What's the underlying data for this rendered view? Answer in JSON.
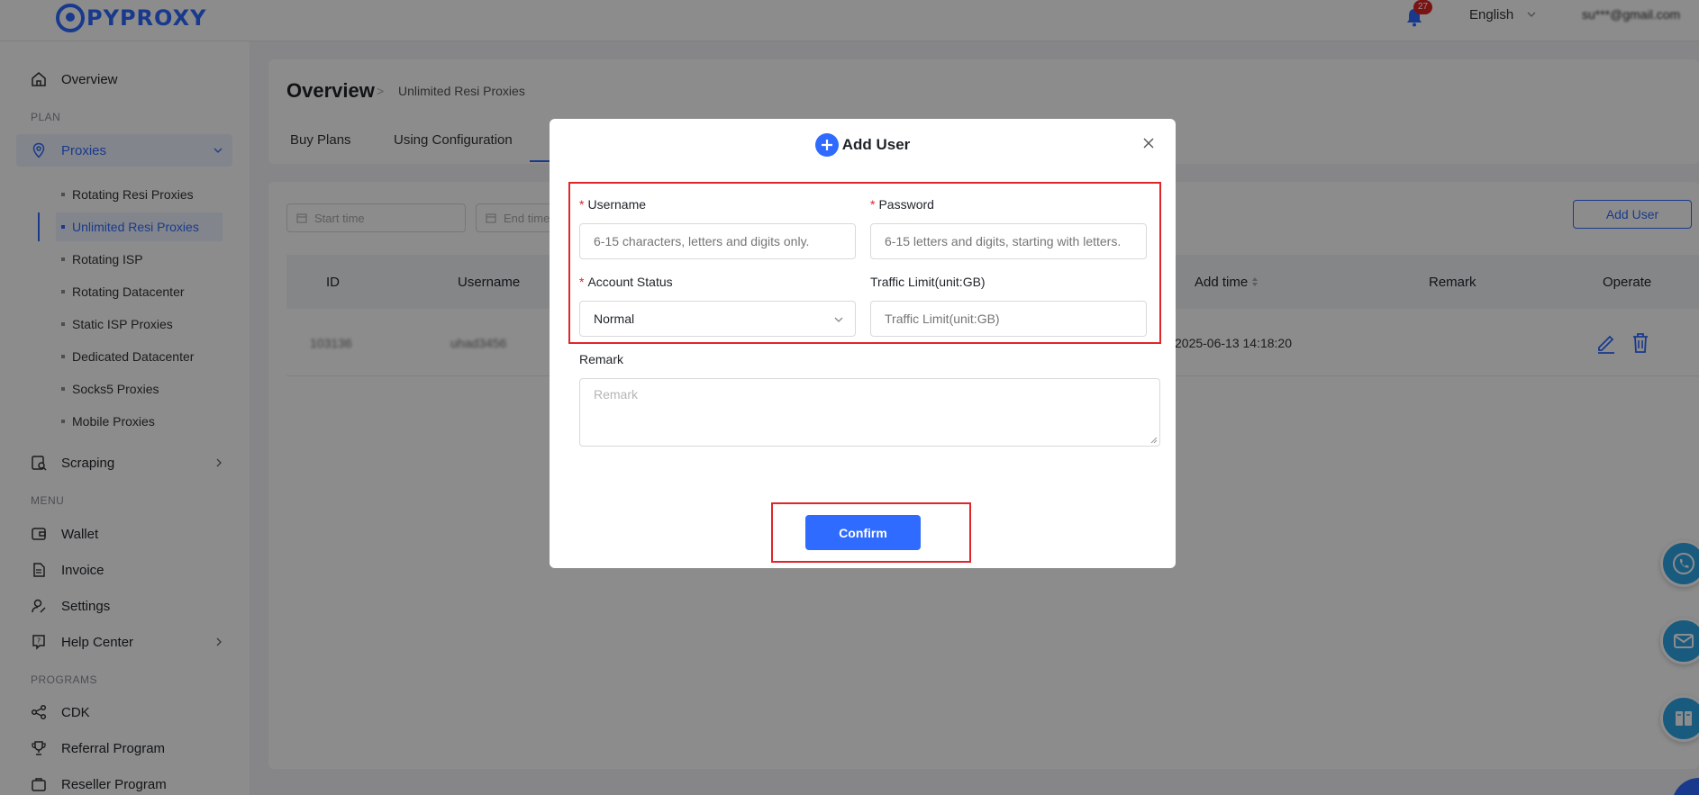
{
  "brand": {
    "logo_text": "PYPROXY"
  },
  "header": {
    "notification_count": "27",
    "language": "English",
    "user_email": "su***@gmail.com"
  },
  "sidebar": {
    "overview": "Overview",
    "section_plan": "PLAN",
    "proxies": "Proxies",
    "proxy_items": [
      "Rotating Resi Proxies",
      "Unlimited Resi Proxies",
      "Rotating ISP",
      "Rotating Datacenter",
      "Static ISP Proxies",
      "Dedicated Datacenter",
      "Socks5 Proxies",
      "Mobile Proxies"
    ],
    "scraping": "Scraping",
    "section_menu": "MENU",
    "wallet": "Wallet",
    "invoice": "Invoice",
    "settings": "Settings",
    "help_center": "Help Center",
    "section_programs": "PROGRAMS",
    "cdk": "CDK",
    "referral": "Referral Program",
    "reseller": "Reseller Program"
  },
  "page": {
    "title": "Overview",
    "breadcrumb": "Unlimited Resi Proxies",
    "tabs": [
      "Buy Plans",
      "Using Configuration"
    ]
  },
  "filters": {
    "start_placeholder": "Start time",
    "end_placeholder": "End time",
    "add_user_label": "Add User"
  },
  "table": {
    "headers": [
      "ID",
      "Username",
      "Add time",
      "Remark",
      "Operate"
    ],
    "row": {
      "id": "103136",
      "username": "uhad3456",
      "add_time": "2025-06-13 14:18:20"
    }
  },
  "modal": {
    "title": "Add User",
    "username_label": "Username",
    "username_placeholder": "6-15 characters, letters and digits only.",
    "password_label": "Password",
    "password_placeholder": "6-15 letters and digits, starting with letters.",
    "status_label": "Account Status",
    "status_value": "Normal",
    "traffic_label": "Traffic Limit(unit:GB)",
    "traffic_placeholder": "Traffic Limit(unit:GB)",
    "remark_label": "Remark",
    "remark_placeholder": "Remark",
    "confirm_label": "Confirm",
    "required_mark": "*"
  },
  "colors": {
    "accent": "#2f6bff",
    "highlight": "#e0262b"
  }
}
